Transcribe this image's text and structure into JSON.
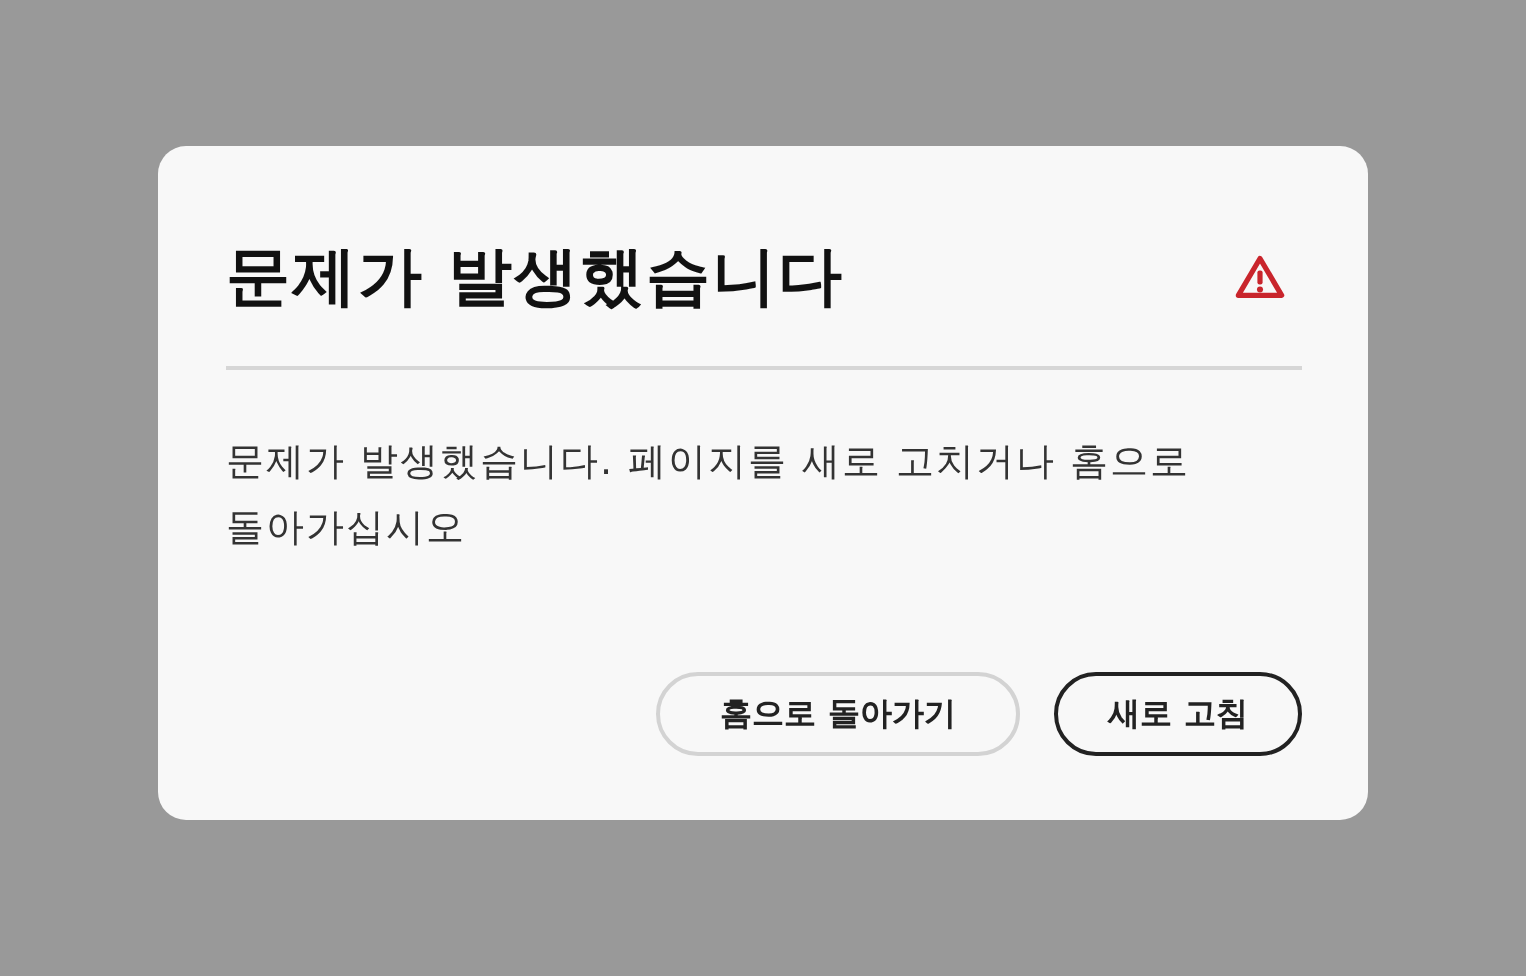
{
  "dialog": {
    "title": "문제가 발생했습니다",
    "message": "문제가 발생했습니다. 페이지를 새로 고치거나 홈으로 돌아가십시오",
    "buttons": [
      {
        "label": "홈으로 돌아가기",
        "kind": "secondary"
      },
      {
        "label": "새로 고침",
        "kind": "primary"
      }
    ]
  }
}
